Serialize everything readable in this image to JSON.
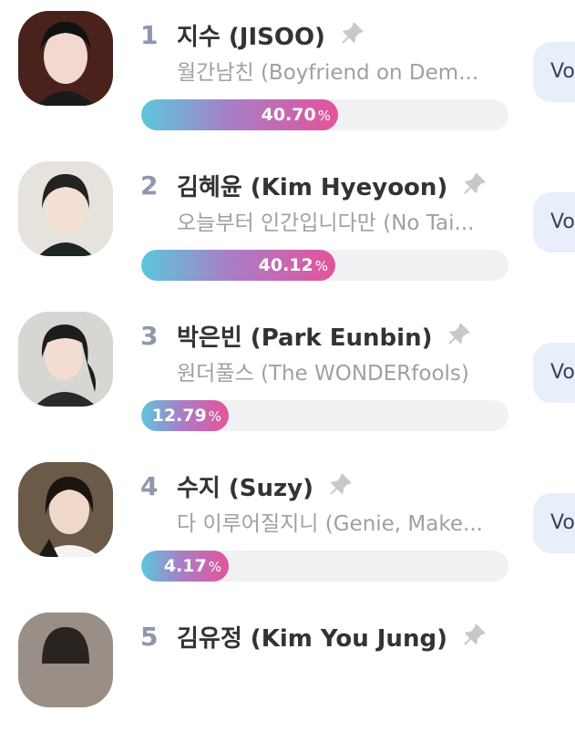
{
  "colors": {
    "rank": "#8e97ad",
    "name": "#333333",
    "subtitle": "#a0a0a0",
    "bar_start": "#5bc7dc",
    "bar_mid": "#a77fc7",
    "bar_end": "#e3539b",
    "track": "#f1f1f3",
    "vote_bg": "#e9eefb",
    "pin": "#c8c8c8"
  },
  "icons": {
    "pin": "pin-icon",
    "avatar": "avatar-photo"
  },
  "ranking": [
    {
      "rank": "1",
      "name": "지수 (JISOO)",
      "drama": "월간남친 (Boyfriend on Dem...",
      "percent_value": 40.7,
      "percent_text": "40.70",
      "percent_symbol": "%",
      "vote_label": "Vo"
    },
    {
      "rank": "2",
      "name": "김혜윤 (Kim Hyeyoon)",
      "drama": "오늘부터 인간입니다만 (No Tai...",
      "percent_value": 40.12,
      "percent_text": "40.12",
      "percent_symbol": "%",
      "vote_label": "Vo"
    },
    {
      "rank": "3",
      "name": "박은빈 (Park Eunbin)",
      "drama": "원더풀스 (The WONDERfools)",
      "percent_value": 12.79,
      "percent_text": "12.79",
      "percent_symbol": "%",
      "vote_label": "Vo"
    },
    {
      "rank": "4",
      "name": "수지 (Suzy)",
      "drama": "다 이루어질지니 (Genie, Make...",
      "percent_value": 4.17,
      "percent_text": "4.17",
      "percent_symbol": "%",
      "vote_label": "Vo"
    },
    {
      "rank": "5",
      "name": "김유정 (Kim You Jung)",
      "drama": "",
      "percent_value": null,
      "percent_text": "",
      "percent_symbol": "",
      "vote_label": ""
    }
  ]
}
